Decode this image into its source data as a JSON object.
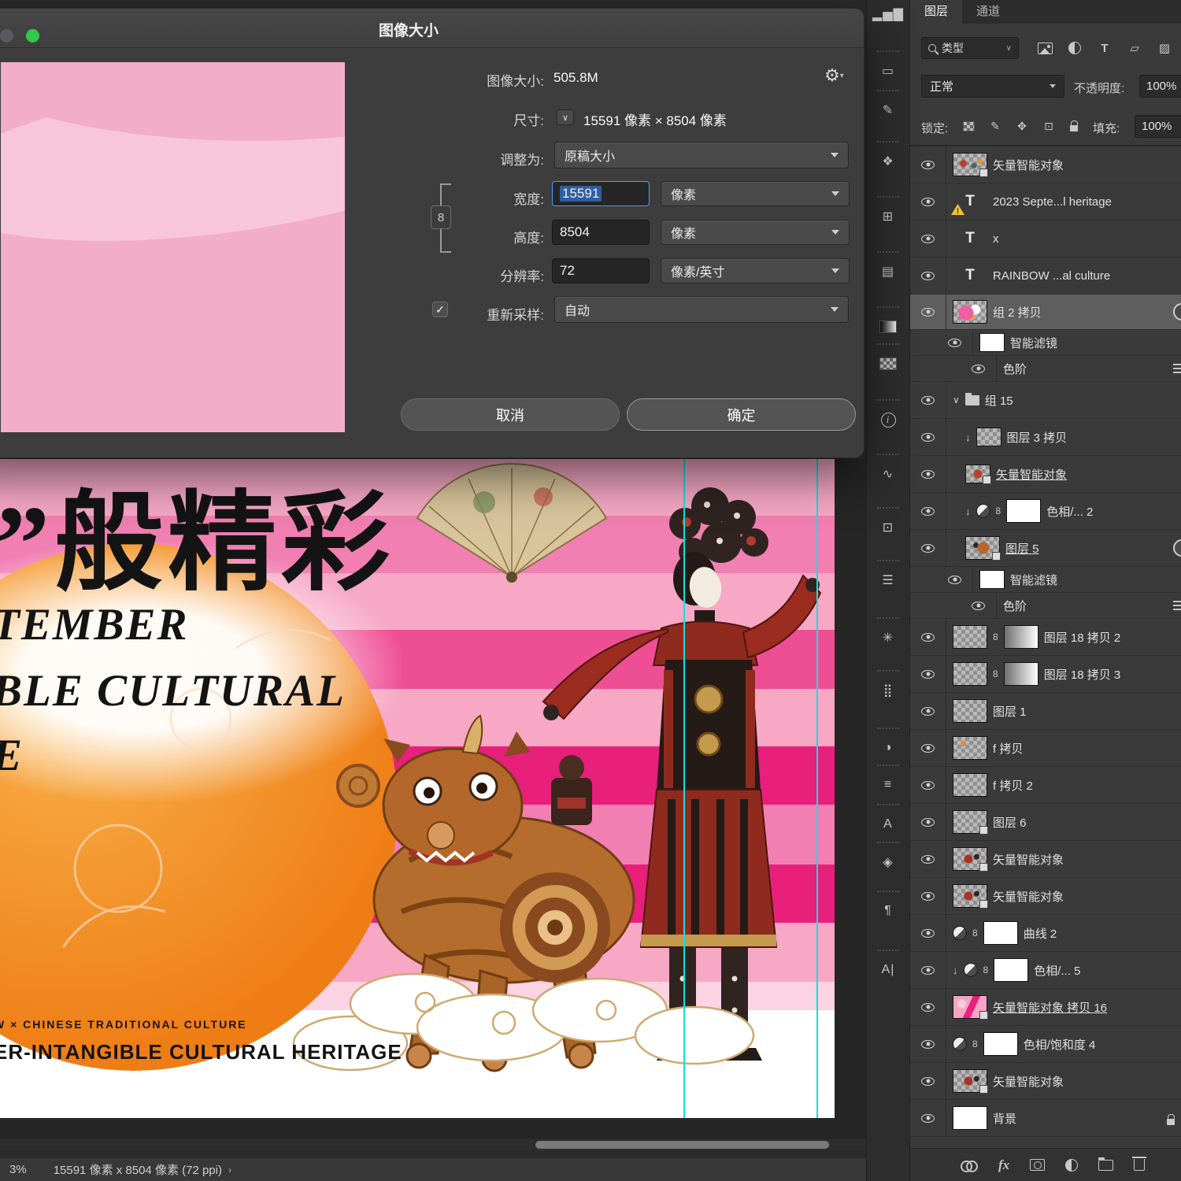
{
  "dialog": {
    "title": "图像大小",
    "size_label": "图像大小:",
    "size_value": "505.8M",
    "dim_label": "尺寸:",
    "dim_value": "15591 像素 × 8504 像素",
    "fit_label": "调整为:",
    "fit_value": "原稿大小",
    "width_label": "宽度:",
    "width_value": "15591",
    "width_unit": "像素",
    "height_label": "高度:",
    "height_value": "8504",
    "height_unit": "像素",
    "res_label": "分辨率:",
    "res_value": "72",
    "res_unit": "像素/英寸",
    "resample_label": "重新采样:",
    "resample_value": "自动",
    "cancel": "取消",
    "ok": "确定"
  },
  "poster": {
    "quote": "”",
    "headline": "般精彩",
    "lines": [
      "TEMBER",
      "BLE CULTURAL",
      "E"
    ],
    "caption_small": "W   ×   CHINESE TRADITIONAL CULTURE",
    "caption_large": "ER-INTANGIBLE CULTURAL HERITAGE"
  },
  "panel": {
    "tab_layers": "图层",
    "tab_channels": "通道",
    "type_label": "类型",
    "blend_mode": "正常",
    "opacity_label": "不透明度:",
    "opacity_value": "100%",
    "lock_label": "锁定:",
    "fill_label": "填充:",
    "fill_value": "100%",
    "fx_label": "fx",
    "layers": [
      {
        "name": "矢量智能对象",
        "thumb": "art1",
        "badge": true
      },
      {
        "name": "2023 Septe...l heritage",
        "thumb": "text",
        "warn": true
      },
      {
        "name": "x",
        "thumb": "text"
      },
      {
        "name": "RAINBOW      ...al culture",
        "thumb": "text"
      },
      {
        "name": "组 2 拷贝",
        "thumb": "art2",
        "selected": true,
        "fx": true
      },
      {
        "name": "智能滤镜",
        "sub": 1,
        "thumb": "white",
        "small": true
      },
      {
        "name": "色阶",
        "sub": 2,
        "rightbars": true
      },
      {
        "name": "组 15",
        "folder": true,
        "expanded": true
      },
      {
        "name": "图层 3 拷贝",
        "indent": 1,
        "clip": true,
        "thumb": "checker",
        "small": true
      },
      {
        "name": "矢量智能对象",
        "indent": 1,
        "thumb": "art3",
        "small": true,
        "badge": true,
        "underline": true
      },
      {
        "name": "色相/... 2",
        "indent": 1,
        "clip": true,
        "adj": true,
        "chain": true,
        "mask": "white"
      },
      {
        "name": "图层 5",
        "indent": 1,
        "thumb": "art4",
        "badge": true,
        "underline": true,
        "fx": true
      },
      {
        "name": "智能滤镜",
        "sub": 1,
        "thumb": "white",
        "small": true
      },
      {
        "name": "色阶",
        "sub": 2,
        "rightbars": true
      },
      {
        "name": "图层 18 拷贝 2",
        "thumb": "checker",
        "chain": true,
        "mask": "gradient"
      },
      {
        "name": "图层 18 拷贝 3",
        "thumb": "checker",
        "chain": true,
        "mask": "gradient"
      },
      {
        "name": "图层 1",
        "thumb": "checker"
      },
      {
        "name": "f 拷贝",
        "thumb": "art5"
      },
      {
        "name": "f 拷贝 2",
        "thumb": "checker"
      },
      {
        "name": "图层 6",
        "thumb": "checker",
        "badge": true
      },
      {
        "name": "矢量智能对象",
        "thumb": "art6",
        "badge": true
      },
      {
        "name": "矢量智能对象",
        "thumb": "art6",
        "badge": true
      },
      {
        "name": "曲线 2",
        "adj": true,
        "chain": true,
        "mask": "white"
      },
      {
        "name": "色相/... 5",
        "clip": true,
        "adj": true,
        "chain": true,
        "mask": "white"
      },
      {
        "name": "矢量智能对象 拷贝 16",
        "thumb": "pink",
        "badge": true,
        "underline": true
      },
      {
        "name": "色相/饱和度 4",
        "adj": true,
        "chain": true,
        "mask": "white"
      },
      {
        "name": "矢量智能对象",
        "thumb": "art6",
        "badge": true
      },
      {
        "name": "背景",
        "thumb": "white",
        "lock": true
      }
    ]
  },
  "dock": {
    "items": [
      {
        "name": "histogram-panel-icon",
        "glyph": "▂▅▇"
      },
      {
        "name": "notes-panel-icon",
        "glyph": "▭"
      },
      {
        "name": "annotate-panel-icon",
        "glyph": "✎"
      },
      {
        "name": "swatches-panel-icon",
        "glyph": "❖"
      },
      {
        "name": "grid-panel-icon",
        "glyph": "⊞"
      },
      {
        "name": "libraries-panel-icon",
        "glyph": "▤"
      },
      {
        "name": "gradients-panel-icon",
        "glyph": "",
        "kind": "gradient"
      },
      {
        "name": "patterns-panel-icon",
        "glyph": "",
        "kind": "checker"
      },
      {
        "name": "info-panel-icon",
        "glyph": "i",
        "kind": "circle"
      },
      {
        "name": "paths-panel-icon",
        "glyph": "∿"
      },
      {
        "name": "layer-comps-panel-icon",
        "glyph": "⊡"
      },
      {
        "name": "brush-settings-panel-icon",
        "glyph": "☰"
      },
      {
        "name": "navigator-panel-icon",
        "glyph": "✳"
      },
      {
        "name": "halftone-panel-icon",
        "glyph": "⣿"
      },
      {
        "name": "adjustments-panel-icon",
        "glyph": "◑"
      },
      {
        "name": "properties-panel-icon",
        "glyph": "≡"
      },
      {
        "name": "glyphs-panel-icon",
        "glyph": "A"
      },
      {
        "name": "3d-panel-icon",
        "glyph": "◈"
      },
      {
        "name": "paragraph-panel-icon",
        "glyph": "¶"
      },
      {
        "name": "character-panel-icon",
        "glyph": "A|"
      }
    ]
  },
  "statusbar": {
    "zoom": "3%",
    "doc": "15591 像素 x 8504 像素 (72 ppi)",
    "chevron": "›"
  }
}
